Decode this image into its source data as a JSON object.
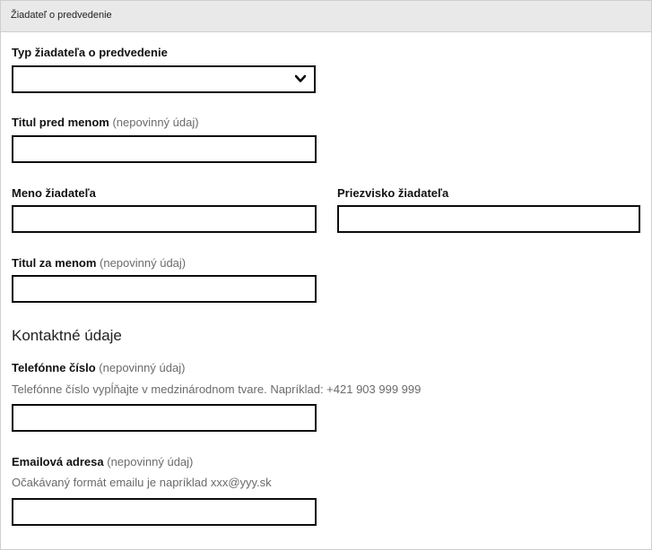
{
  "panel": {
    "title": "Žiadateľ o predvedenie"
  },
  "form": {
    "applicant_type": {
      "label": "Typ žiadateľa o predvedenie",
      "value": ""
    },
    "title_before": {
      "label": "Titul pred menom",
      "optional": "(nepovinný údaj)",
      "value": ""
    },
    "first_name": {
      "label": "Meno žiadateľa",
      "value": ""
    },
    "last_name": {
      "label": "Priezvisko žiadateľa",
      "value": ""
    },
    "title_after": {
      "label": "Titul za menom",
      "optional": "(nepovinný údaj)",
      "value": ""
    }
  },
  "contact": {
    "heading": "Kontaktné údaje",
    "phone": {
      "label": "Telefónne číslo",
      "optional": "(nepovinný údaj)",
      "hint": "Telefónne číslo vypĺňajte v medzinárodnom tvare. Napríklad: +421 903 999 999",
      "value": ""
    },
    "email": {
      "label": "Emailová adresa",
      "optional": "(nepovinný údaj)",
      "hint": "Očakávaný formát emailu je napríklad xxx@yyy.sk",
      "value": ""
    }
  },
  "icons": {
    "select_chevron": "chevron-down-icon"
  }
}
